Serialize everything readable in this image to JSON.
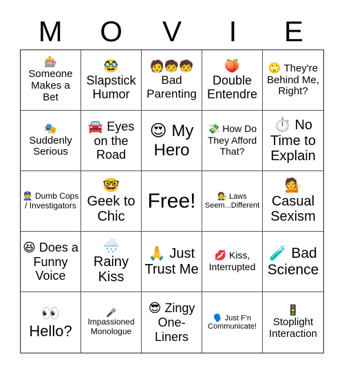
{
  "title_letters": [
    "M",
    "O",
    "V",
    "I",
    "E"
  ],
  "cells": [
    {
      "icon": "🎰",
      "icon_name": "slot-machine-icon",
      "text": "Someone Makes a Bet",
      "size": "s15",
      "icon_block": true
    },
    {
      "icon": "🥸",
      "icon_name": "disguised-face-icon",
      "text": "Slapstick Humor",
      "size": "s18",
      "icon_block": true
    },
    {
      "icon": "🧑🧒🧒",
      "icon_name": "family-icon",
      "text": "Bad Parenting",
      "size": "s17",
      "icon_block": true
    },
    {
      "icon": "🍑",
      "icon_name": "peach-icon",
      "text": "Double Entendre",
      "size": "s18",
      "icon_block": true
    },
    {
      "icon": "🙄",
      "icon_name": "eye-roll-icon",
      "text": "They're Behind Me, Right?",
      "size": "s15",
      "icon_block": false
    },
    {
      "icon": "🎭",
      "icon_name": "theater-masks-icon",
      "text": "Suddenly Serious",
      "size": "s15",
      "icon_block": true
    },
    {
      "icon": "🚘",
      "icon_name": "car-icon",
      "text": "Eyes on the Road",
      "size": "s18",
      "icon_block": false
    },
    {
      "icon": "😍",
      "icon_name": "heart-eyes-icon",
      "text": "My Hero",
      "size": "s24",
      "icon_block": false
    },
    {
      "icon": "💸",
      "icon_name": "money-wings-icon",
      "text": "How Do They Afford That?",
      "size": "s14",
      "icon_block": false
    },
    {
      "icon": "⏱️",
      "icon_name": "stopwatch-icon",
      "text": "No Time to Explain",
      "size": "s20",
      "icon_block": false
    },
    {
      "icon": "👮",
      "icon_name": "police-officer-icon",
      "text": "Dumb Cops / Investigators",
      "size": "s12",
      "icon_block": false
    },
    {
      "icon": "🤓",
      "icon_name": "nerd-face-icon",
      "text": "Geek to Chic",
      "size": "s20",
      "icon_block": true
    },
    {
      "icon": "",
      "icon_name": "",
      "text": "Free!",
      "size": "s30",
      "icon_block": false,
      "free": true
    },
    {
      "icon": "🧑‍⚖️",
      "icon_name": "judge-icon",
      "text": "Laws Seem...Different",
      "size": "s11",
      "icon_block": false
    },
    {
      "icon": "💁",
      "icon_name": "person-tipping-hand-icon",
      "text": "Casual Sexism",
      "size": "s20",
      "icon_block": true
    },
    {
      "icon": "😆",
      "icon_name": "laughing-face-icon",
      "text": "Does a Funny Voice",
      "size": "s18",
      "icon_block": false
    },
    {
      "icon": "🌧️",
      "icon_name": "rain-cloud-icon",
      "text": "Rainy Kiss",
      "size": "s20",
      "icon_block": true
    },
    {
      "icon": "🙏",
      "icon_name": "folded-hands-icon",
      "text": "Just Trust Me",
      "size": "s20",
      "icon_block": false
    },
    {
      "icon": "💋",
      "icon_name": "kiss-mark-icon",
      "text": "Kiss, Interrupted",
      "size": "s14",
      "icon_block": false
    },
    {
      "icon": "🧪",
      "icon_name": "test-tube-icon",
      "text": "Bad Science",
      "size": "s21",
      "icon_block": false
    },
    {
      "icon": "👀",
      "icon_name": "eyes-icon",
      "text": "Hello?",
      "size": "s22",
      "icon_block": true
    },
    {
      "icon": "🎤",
      "icon_name": "microphone-icon",
      "text": "Impassioned Monologue",
      "size": "s12",
      "icon_block": true
    },
    {
      "icon": "😎",
      "icon_name": "sunglasses-face-icon",
      "text": "Zingy One-Liners",
      "size": "s18",
      "icon_block": false
    },
    {
      "icon": "🗣️",
      "icon_name": "speaking-head-icon",
      "text": "Just F'n Communicate!",
      "size": "s11",
      "icon_block": false
    },
    {
      "icon": "🚦",
      "icon_name": "traffic-light-icon",
      "text": "Stoplight Interaction",
      "size": "s15",
      "icon_block": true
    }
  ]
}
